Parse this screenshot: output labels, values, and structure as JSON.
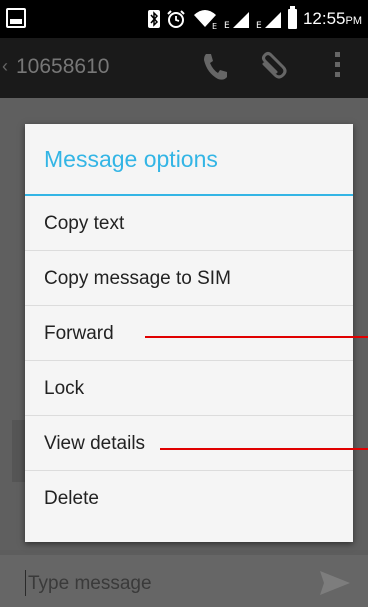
{
  "status_bar": {
    "time": "12:55",
    "ampm": "PM",
    "icons": [
      "gallery-icon",
      "bluetooth-icon",
      "alarm-icon",
      "wifi-icon",
      "signal-icon",
      "signal-icon",
      "battery-icon"
    ]
  },
  "action_bar": {
    "contact_number": "10658610",
    "icons": [
      "back-chevron-icon",
      "phone-icon",
      "paperclip-icon",
      "overflow-menu-icon"
    ]
  },
  "dialog": {
    "title": "Message options",
    "accent_color": "#33b5e5",
    "options": [
      {
        "label": "Copy text"
      },
      {
        "label": "Copy message to SIM"
      },
      {
        "label": "Forward"
      },
      {
        "label": "Lock"
      },
      {
        "label": "View details"
      },
      {
        "label": "Delete"
      }
    ]
  },
  "compose": {
    "placeholder": "Type message"
  },
  "annotation_color": "#e00000"
}
